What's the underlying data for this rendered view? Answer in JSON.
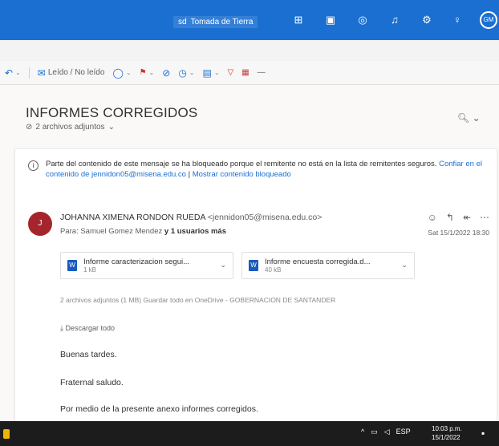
{
  "topbar": {
    "mode_label": "Tomada de Tierra",
    "mode_icon": "sd",
    "avatar_initials": "GM",
    "icons": [
      "teams-icon",
      "word-icon",
      "outlook-icon",
      "bell-icon",
      "gear-icon",
      "lightbulb-icon"
    ]
  },
  "toolbar": {
    "reply_all_label": "Leído / No leído"
  },
  "message": {
    "subject": "INFORMES CORREGIDOS",
    "attachments_count": "2 archivos adjuntos",
    "info_notice": "Parte del contenido de este mensaje se ha bloqueado porque el remitente no está en la lista de remitentes seguros.",
    "info_link1": "Confiar en el contenido de jennidon05@misena.edu.co",
    "info_sep": " | ",
    "info_link2": "Mostrar contenido bloqueado",
    "sender_initial": "J",
    "sender_name": "JOHANNA XIMENA RONDON RUEDA",
    "sender_email": "<jennidon05@misena.edu.co>",
    "to_prefix": "Para: Samuel Gomez Mendez",
    "to_extra": "y 1 usuarios más",
    "date": "Sat 15/1/2022 18:30",
    "files": [
      {
        "name": "Informe caracterizacion segui...",
        "size": "1 kB"
      },
      {
        "name": "Informe encuesta corregida.d...",
        "size": "40 kB"
      }
    ],
    "attachment_summary": "2 archivos adjuntos (1 MB)   Guardar todo en OneDrive - GOBERNACION DE SANTANDER",
    "download_all": "Descargar todo",
    "body": [
      "Buenas tardes.",
      "Fraternal saludo.",
      "Por medio de la presente anexo informes corregidos."
    ]
  },
  "taskbar": {
    "lang": "ESP",
    "time": "10:03 p.m.",
    "date": "15/1/2022"
  }
}
